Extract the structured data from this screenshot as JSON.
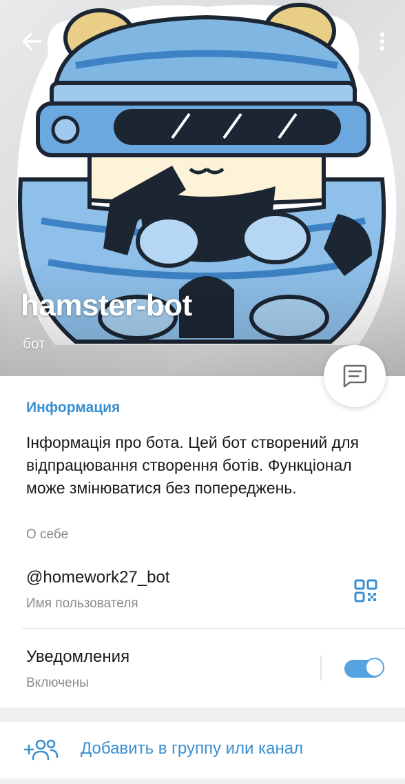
{
  "header": {
    "bot_name": "hamster-bot",
    "subtitle": "бот",
    "back_icon": "arrow-left-icon",
    "more_icon": "more-vertical-icon",
    "chat_icon": "message-icon"
  },
  "info": {
    "section_title": "Информация",
    "about_text": "Інформація про бота. Цей бот створений для відпрацювання створення ботів. Функціонал може змінюватися без попереджень.",
    "about_label": "О себе",
    "username": "@homework27_bot",
    "username_label": "Имя пользователя",
    "qr_icon": "qr-code-icon",
    "notifications_title": "Уведомления",
    "notifications_status": "Включены",
    "notifications_enabled": true
  },
  "actions": {
    "add_to_group_label": "Добавить в группу или канал",
    "add_icon": "add-user-group-icon"
  },
  "colors": {
    "accent": "#3a8fd0",
    "toggle": "#56a3e0",
    "avatar_blue": "#7fb6e2"
  }
}
